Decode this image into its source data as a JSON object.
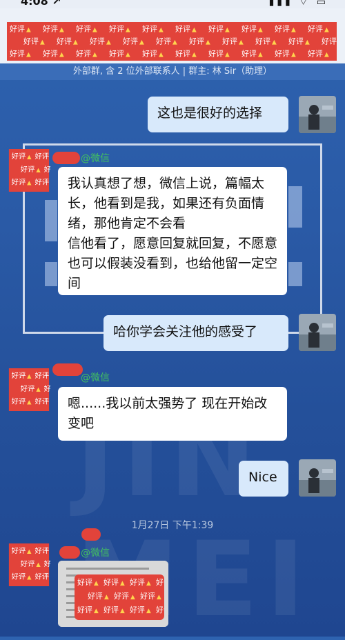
{
  "status_bar": {
    "time": "4:08 ↗",
    "icons": "▮▮▮ ⌔ ▭"
  },
  "header": {
    "redacted_stamp_text": "好评"
  },
  "group_info": {
    "text": "外部群, 含 2 位外部联系人 | 群主: 林 Sir（助理）"
  },
  "background": {
    "watermark": "JIN MEI"
  },
  "messages": [
    {
      "id": "m1",
      "side": "self",
      "text": "这也是很好的选择"
    },
    {
      "id": "m2",
      "side": "other",
      "sender_suffix": "@微信",
      "text": "我认真想了想，微信上说，篇幅太长，他看到是我，如果还有负面情绪，那他肯定不会看\n信他看了，愿意回复就回复，不愿意也可以假装没看到，也给他留一定空间"
    },
    {
      "id": "m3",
      "side": "self",
      "text": "哈你学会关注他的感受了"
    },
    {
      "id": "m4",
      "side": "other",
      "sender_suffix": "@微信",
      "text": "嗯......我以前太强势了 现在开始改变吧"
    },
    {
      "id": "m5",
      "side": "self",
      "text": "Nice"
    },
    {
      "id": "ts1",
      "type": "timestamp",
      "text": "1月27日 下午1:39"
    },
    {
      "id": "m6",
      "side": "other",
      "sender_suffix": "@微信",
      "type": "image"
    }
  ],
  "colors": {
    "background": "#2a5aa6",
    "self_bubble": "#d8e9fb",
    "other_bubble": "#ffffff",
    "sender_green": "#43c25f",
    "redaction_red": "#e2433a"
  }
}
